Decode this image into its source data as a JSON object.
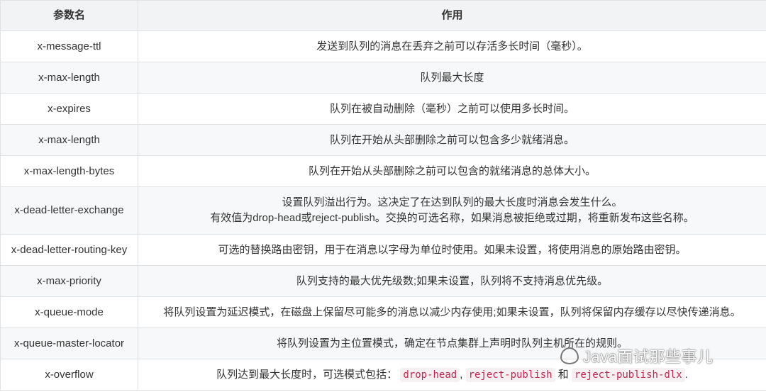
{
  "table": {
    "headers": [
      "参数名",
      "作用"
    ],
    "rows": [
      {
        "name": "x-message-ttl",
        "desc": "发送到队列的消息在丢弃之前可以存活多长时间（毫秒）。"
      },
      {
        "name": "x-max-length",
        "desc": "队列最大长度"
      },
      {
        "name": "x-expires",
        "desc": "队列在被自动删除（毫秒）之前可以使用多长时间。"
      },
      {
        "name": "x-max-length",
        "desc": "队列在开始从头部删除之前可以包含多少就绪消息。"
      },
      {
        "name": "x-max-length-bytes",
        "desc": "队列在开始从头部删除之前可以包含的就绪消息的总体大小。"
      },
      {
        "name": "x-dead-letter-exchange",
        "desc_line1": "设置队列溢出行为。这决定了在达到队列的最大长度时消息会发生什么。",
        "desc_line2": "有效值为drop-head或reject-publish。交换的可选名称，如果消息被拒绝或过期，将重新发布这些名称。"
      },
      {
        "name": "x-dead-letter-routing-key",
        "desc": "可选的替换路由密钥，用于在消息以字母为单位时使用。如果未设置，将使用消息的原始路由密钥。"
      },
      {
        "name": "x-max-priority",
        "desc": "队列支持的最大优先级数;如果未设置，队列将不支持消息优先级。"
      },
      {
        "name": "x-queue-mode",
        "desc": "将队列设置为延迟模式，在磁盘上保留尽可能多的消息以减少内存使用;如果未设置，队列将保留内存缓存以尽快传递消息。"
      },
      {
        "name": "x-queue-master-locator",
        "desc": "将队列设置为主位置模式，确定在节点集群上声明时队列主机所在的规则。"
      },
      {
        "name": "x-overflow",
        "desc_prefix": "队列达到最大长度时，可选模式包括：",
        "code1": "drop-head",
        "sep1": ",",
        "code2": "reject-publish",
        "sep2": "和",
        "code3": "reject-publish-dlx",
        "suffix": "."
      }
    ]
  },
  "watermark": {
    "text": "Java面试那些事儿",
    "icon": "wechat-icon"
  }
}
